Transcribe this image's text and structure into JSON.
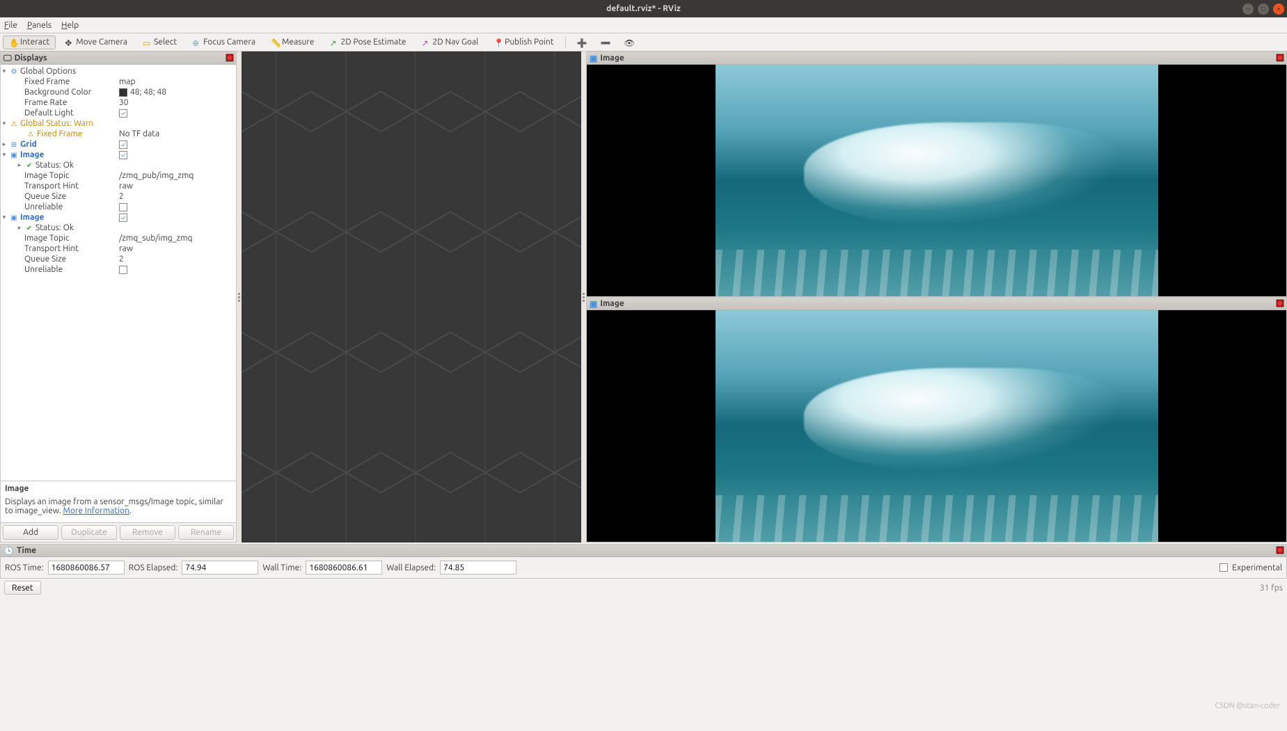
{
  "window": {
    "title": "default.rviz* - RViz"
  },
  "menu": {
    "file": "File",
    "panels": "Panels",
    "help": "Help"
  },
  "toolbar": {
    "interact": "Interact",
    "move_camera": "Move Camera",
    "select": "Select",
    "focus_camera": "Focus Camera",
    "measure": "Measure",
    "pose_estimate": "2D Pose Estimate",
    "nav_goal": "2D Nav Goal",
    "publish_point": "Publish Point"
  },
  "displays": {
    "panel_title": "Displays",
    "global_options": {
      "label": "Global Options",
      "fixed_frame": {
        "label": "Fixed Frame",
        "value": "map"
      },
      "background_color": {
        "label": "Background Color",
        "value": "48; 48; 48"
      },
      "frame_rate": {
        "label": "Frame Rate",
        "value": "30"
      },
      "default_light": {
        "label": "Default Light",
        "checked": true
      }
    },
    "global_status": {
      "label": "Global Status: Warn",
      "fixed_frame": {
        "label": "Fixed Frame",
        "value": "No TF data"
      }
    },
    "grid": {
      "label": "Grid",
      "checked": true
    },
    "image1": {
      "label": "Image",
      "checked": true,
      "status": "Status: Ok",
      "image_topic": {
        "label": "Image Topic",
        "value": "/zmq_pub/img_zmq"
      },
      "transport_hint": {
        "label": "Transport Hint",
        "value": "raw"
      },
      "queue_size": {
        "label": "Queue Size",
        "value": "2"
      },
      "unreliable": {
        "label": "Unreliable",
        "checked": false
      }
    },
    "image2": {
      "label": "Image",
      "checked": true,
      "status": "Status: Ok",
      "image_topic": {
        "label": "Image Topic",
        "value": "/zmq_sub/img_zmq"
      },
      "transport_hint": {
        "label": "Transport Hint",
        "value": "raw"
      },
      "queue_size": {
        "label": "Queue Size",
        "value": "2"
      },
      "unreliable": {
        "label": "Unreliable",
        "checked": false
      }
    }
  },
  "description": {
    "title": "Image",
    "text": "Displays an image from a sensor_msgs/Image topic, similar to image_view. ",
    "link": "More Information"
  },
  "buttons": {
    "add": "Add",
    "duplicate": "Duplicate",
    "remove": "Remove",
    "rename": "Rename"
  },
  "image_panel": {
    "title": "Image"
  },
  "time": {
    "panel_title": "Time",
    "ros_time_label": "ROS Time:",
    "ros_time": "1680860086.57",
    "ros_elapsed_label": "ROS Elapsed:",
    "ros_elapsed": "74.94",
    "wall_time_label": "Wall Time:",
    "wall_time": "1680860086.61",
    "wall_elapsed_label": "Wall Elapsed:",
    "wall_elapsed": "74.85",
    "experimental": "Experimental"
  },
  "footer": {
    "reset": "Reset",
    "fps": "31 fps"
  },
  "watermark": "CSDN @stan-coder"
}
